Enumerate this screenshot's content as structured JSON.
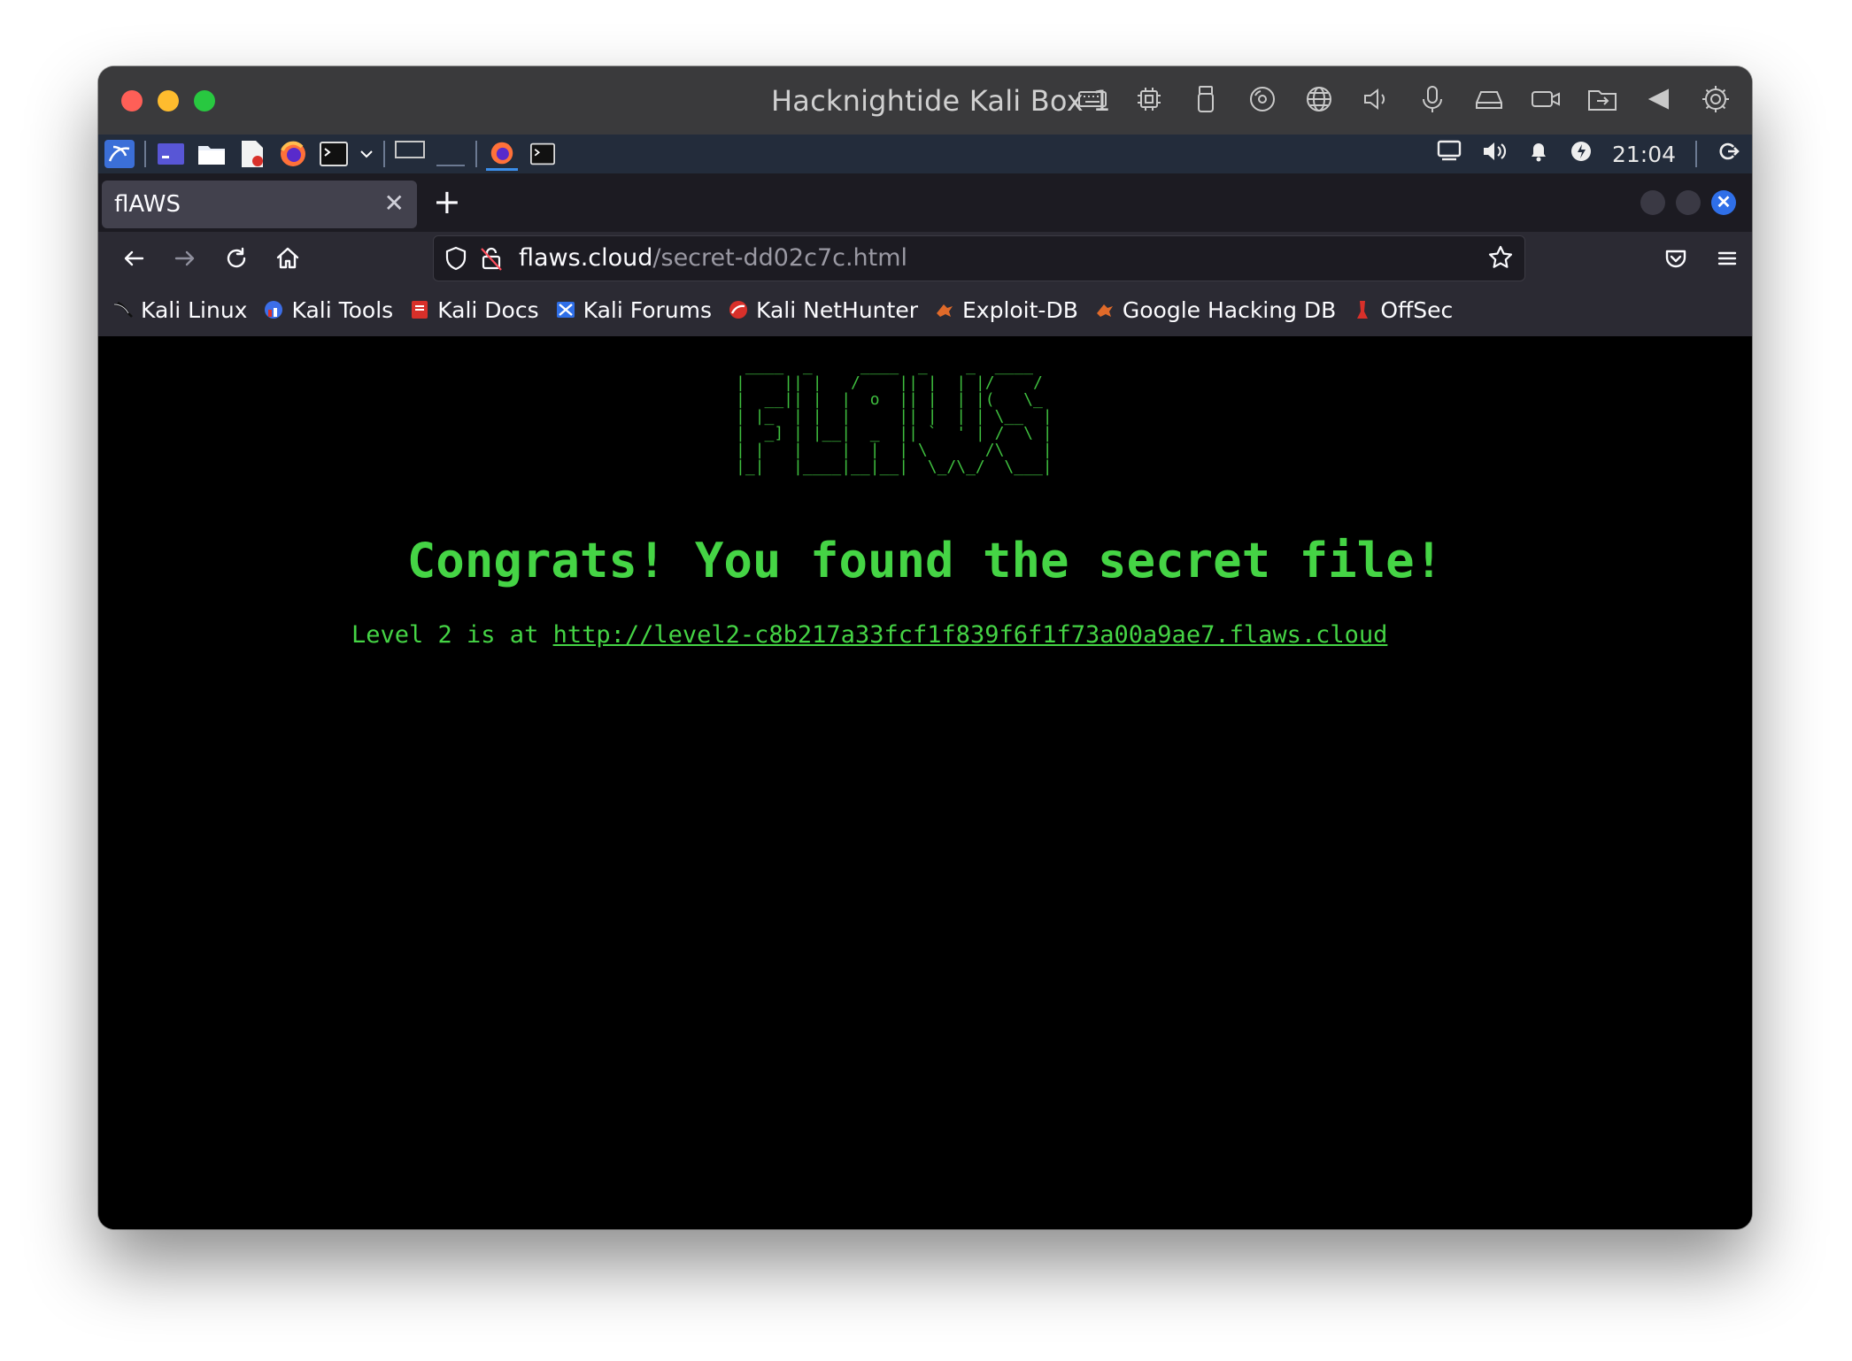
{
  "window": {
    "title": "Hacknightide Kali Box 1"
  },
  "vm_toolbar": {
    "icons": [
      "keyboard-icon",
      "cpu-icon",
      "usb-icon",
      "disc-icon",
      "network-globe-icon",
      "speaker-icon",
      "microphone-icon",
      "drive-icon",
      "camera-icon",
      "shared-folder-icon",
      "back-arrow-icon",
      "settings-gear-icon"
    ]
  },
  "panel": {
    "clock": "21:04"
  },
  "browser": {
    "tab_title": "flAWS",
    "url_host": "flaws.cloud",
    "url_path": "/secret-dd02c7c.html"
  },
  "bookmarks": [
    {
      "label": "Kali Linux",
      "color": "#1f2a44"
    },
    {
      "label": "Kali Tools",
      "color": "#3c6ee8"
    },
    {
      "label": "Kali Docs",
      "color": "#d8302a"
    },
    {
      "label": "Kali Forums",
      "color": "#2f6fe8"
    },
    {
      "label": "Kali NetHunter",
      "color": "#d8302a"
    },
    {
      "label": "Exploit-DB",
      "color": "#e06a2a"
    },
    {
      "label": "Google Hacking DB",
      "color": "#e06a2a"
    },
    {
      "label": "OffSec",
      "color": "#d8302a"
    }
  ],
  "page": {
    "ascii_logo": " ____  _     ____  _    _  ____\n|    || |   /    || |  | |/    /\n|  __|| |  |  o  || |  | |(   \\_\n| |_  | |  |     || |  | | \\__  |\n|  _] | |__|  _  || `  ' | /  \\ |\n| |   |    |  |  | \\      /\\    |\n|_|   |____|__|__|  \\_/\\_/  \\___|",
    "heading": "Congrats! You found the secret file!",
    "level_prefix": "Level 2 is at ",
    "level_link": "http://level2-c8b217a33fcf1f839f6f1f73a00a9ae7.flaws.cloud"
  }
}
